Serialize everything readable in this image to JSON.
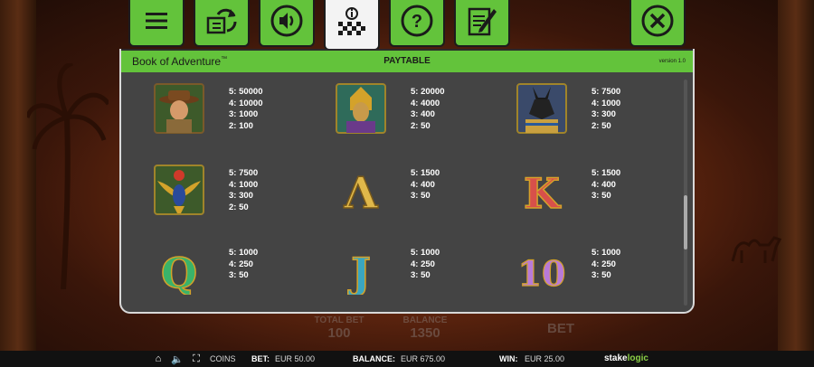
{
  "panel": {
    "game_title": "Book of Adventure",
    "trademark": "™",
    "section_title": "PAYTABLE",
    "version": "version 1.0"
  },
  "tabs": [
    {
      "icon": "menu-icon"
    },
    {
      "icon": "autoplay-icon"
    },
    {
      "icon": "sound-icon"
    },
    {
      "icon": "paytable-icon",
      "active": true
    },
    {
      "icon": "help-icon"
    },
    {
      "icon": "history-icon"
    },
    {
      "icon": "close-icon"
    }
  ],
  "symbols": [
    {
      "name": "explorer",
      "pays": [
        "5: 50000",
        "4: 10000",
        "3: 1000",
        "2: 100"
      ]
    },
    {
      "name": "pharaoh",
      "pays": [
        "5: 20000",
        "4: 4000",
        "3: 400",
        "2: 50"
      ]
    },
    {
      "name": "anubis",
      "pays": [
        "5: 7500",
        "4: 1000",
        "3: 300",
        "2: 50"
      ]
    },
    {
      "name": "scarab",
      "pays": [
        "5: 7500",
        "4: 1000",
        "3: 300",
        "2: 50"
      ]
    },
    {
      "name": "A",
      "letter": "A",
      "pays": [
        "5: 1500",
        "4: 400",
        "3: 50"
      ]
    },
    {
      "name": "K",
      "letter": "K",
      "pays": [
        "5: 1500",
        "4: 400",
        "3: 50"
      ]
    },
    {
      "name": "Q",
      "letter": "Q",
      "pays": [
        "5: 1000",
        "4: 250",
        "3: 50"
      ]
    },
    {
      "name": "J",
      "letter": "J",
      "pays": [
        "5: 1000",
        "4: 250",
        "3: 50"
      ]
    },
    {
      "name": "10",
      "letter": "10",
      "pays": [
        "5: 1000",
        "4: 250",
        "3: 50"
      ]
    }
  ],
  "background_controls": {
    "total_bet_label": "TOTAL BET",
    "total_bet_value": "100",
    "balance_label": "BALANCE",
    "balance_value": "1350",
    "bet_button": "BET"
  },
  "statusbar": {
    "coins_label": "COINS",
    "bet_label": "BET:",
    "bet_value": "EUR 50.00",
    "balance_label": "BALANCE:",
    "balance_value": "EUR 675.00",
    "win_label": "WIN:",
    "win_value": "EUR 25.00",
    "brand_a": "stake",
    "brand_b": "logic"
  },
  "colors": {
    "accent_green": "#63c33b",
    "panel_bg": "#444444"
  }
}
